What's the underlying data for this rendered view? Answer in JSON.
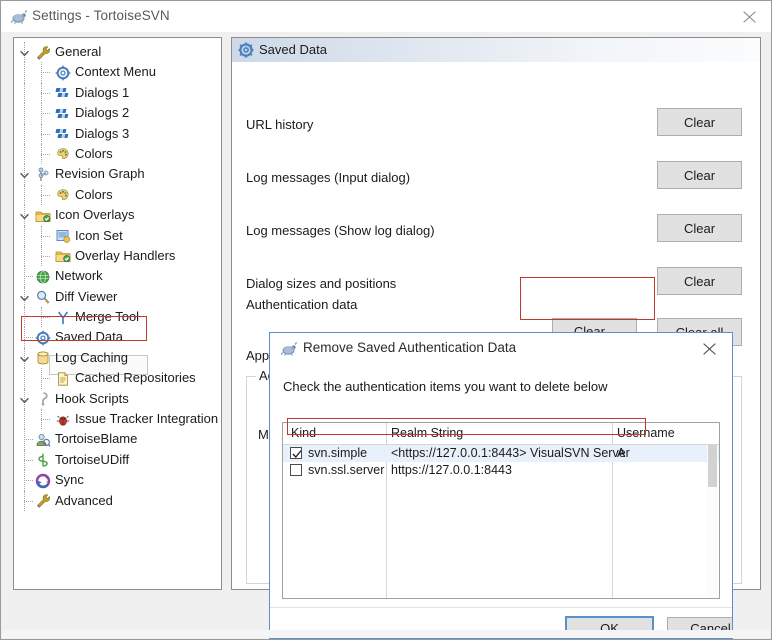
{
  "window": {
    "title": "Settings - TortoiseSVN",
    "icon": "tortoise-icon",
    "close_label": "✕"
  },
  "sidebar": {
    "items": [
      {
        "label": "General",
        "icon": "wrench-icon",
        "depth": 0,
        "chevron": "expanded"
      },
      {
        "label": "Context Menu",
        "icon": "gear-icon",
        "depth": 1,
        "chevron": "none"
      },
      {
        "label": "Dialogs 1",
        "icon": "checkers-icon",
        "depth": 1,
        "chevron": "none"
      },
      {
        "label": "Dialogs 2",
        "icon": "checkers-icon",
        "depth": 1,
        "chevron": "none"
      },
      {
        "label": "Dialogs 3",
        "icon": "checkers-icon",
        "depth": 1,
        "chevron": "none"
      },
      {
        "label": "Colors",
        "icon": "palette-icon",
        "depth": 1,
        "chevron": "none"
      },
      {
        "label": "Revision Graph",
        "icon": "graph-icon",
        "depth": 0,
        "chevron": "expanded"
      },
      {
        "label": "Colors",
        "icon": "palette-icon",
        "depth": 1,
        "chevron": "none"
      },
      {
        "label": "Icon Overlays",
        "icon": "folder-green-icon",
        "depth": 0,
        "chevron": "expanded"
      },
      {
        "label": "Icon Set",
        "icon": "iconset-icon",
        "depth": 1,
        "chevron": "none"
      },
      {
        "label": "Overlay Handlers",
        "icon": "folder-green-icon",
        "depth": 1,
        "chevron": "none"
      },
      {
        "label": "Network",
        "icon": "globe-icon",
        "depth": 0,
        "chevron": "none"
      },
      {
        "label": "Diff Viewer",
        "icon": "magnifier-icon",
        "depth": 0,
        "chevron": "expanded"
      },
      {
        "label": "Merge Tool",
        "icon": "merge-icon",
        "depth": 1,
        "chevron": "none"
      },
      {
        "label": "Saved Data",
        "icon": "gear-icon",
        "depth": 0,
        "chevron": "none",
        "selected": true
      },
      {
        "label": "Log Caching",
        "icon": "database-icon",
        "depth": 0,
        "chevron": "expanded"
      },
      {
        "label": "Cached Repositories",
        "icon": "document-icon",
        "depth": 1,
        "chevron": "none"
      },
      {
        "label": "Hook Scripts",
        "icon": "hook-icon",
        "depth": 0,
        "chevron": "expanded"
      },
      {
        "label": "Issue Tracker Integration",
        "icon": "bug-icon",
        "depth": 1,
        "chevron": "none"
      },
      {
        "label": "TortoiseBlame",
        "icon": "person-icon",
        "depth": 0,
        "chevron": "none"
      },
      {
        "label": "TortoiseUDiff",
        "icon": "udiff-icon",
        "depth": 0,
        "chevron": "none"
      },
      {
        "label": "Sync",
        "icon": "sync-icon",
        "depth": 0,
        "chevron": "none"
      },
      {
        "label": "Advanced",
        "icon": "wrench-icon",
        "depth": 0,
        "chevron": "none"
      }
    ]
  },
  "pane": {
    "header": "Saved Data",
    "header_icon": "gear-icon",
    "rows": [
      {
        "label": "URL history",
        "button": "Clear"
      },
      {
        "label": "Log messages (Input dialog)",
        "button": "Clear"
      },
      {
        "label": "Log messages (Show log dialog)",
        "button": "Clear"
      },
      {
        "label": "Dialog sizes and positions",
        "button": "Clear"
      }
    ],
    "auth": {
      "label": "Authentication data",
      "clear_button": "Clear...",
      "clear_all_button": "Clear all"
    },
    "obscured": {
      "app_text": "App",
      "group_text": "Ac",
      "inner_text": "Ma"
    }
  },
  "dialog": {
    "title": "Remove Saved Authentication Data",
    "icon": "tortoise-icon",
    "close_label": "✕",
    "instruction": "Check the authentication items you want to delete below",
    "columns": [
      "Kind",
      "Realm String",
      "Username"
    ],
    "rows": [
      {
        "checked": true,
        "kind": "svn.simple",
        "realm": "<https://127.0.0.1:8443> VisualSVN Server",
        "username": "A",
        "selected": true,
        "annotated": true
      },
      {
        "checked": false,
        "kind": "svn.ssl.server",
        "realm": "https://127.0.0.1:8443",
        "username": "",
        "selected": false,
        "annotated": false
      }
    ],
    "ok_button": "OK",
    "cancel_button": "Cancel"
  },
  "annotations": {
    "color": "#c0392b",
    "targets": [
      "sidebar-item-saved-data",
      "auth-clear-button",
      "auth-table-row-1"
    ]
  }
}
